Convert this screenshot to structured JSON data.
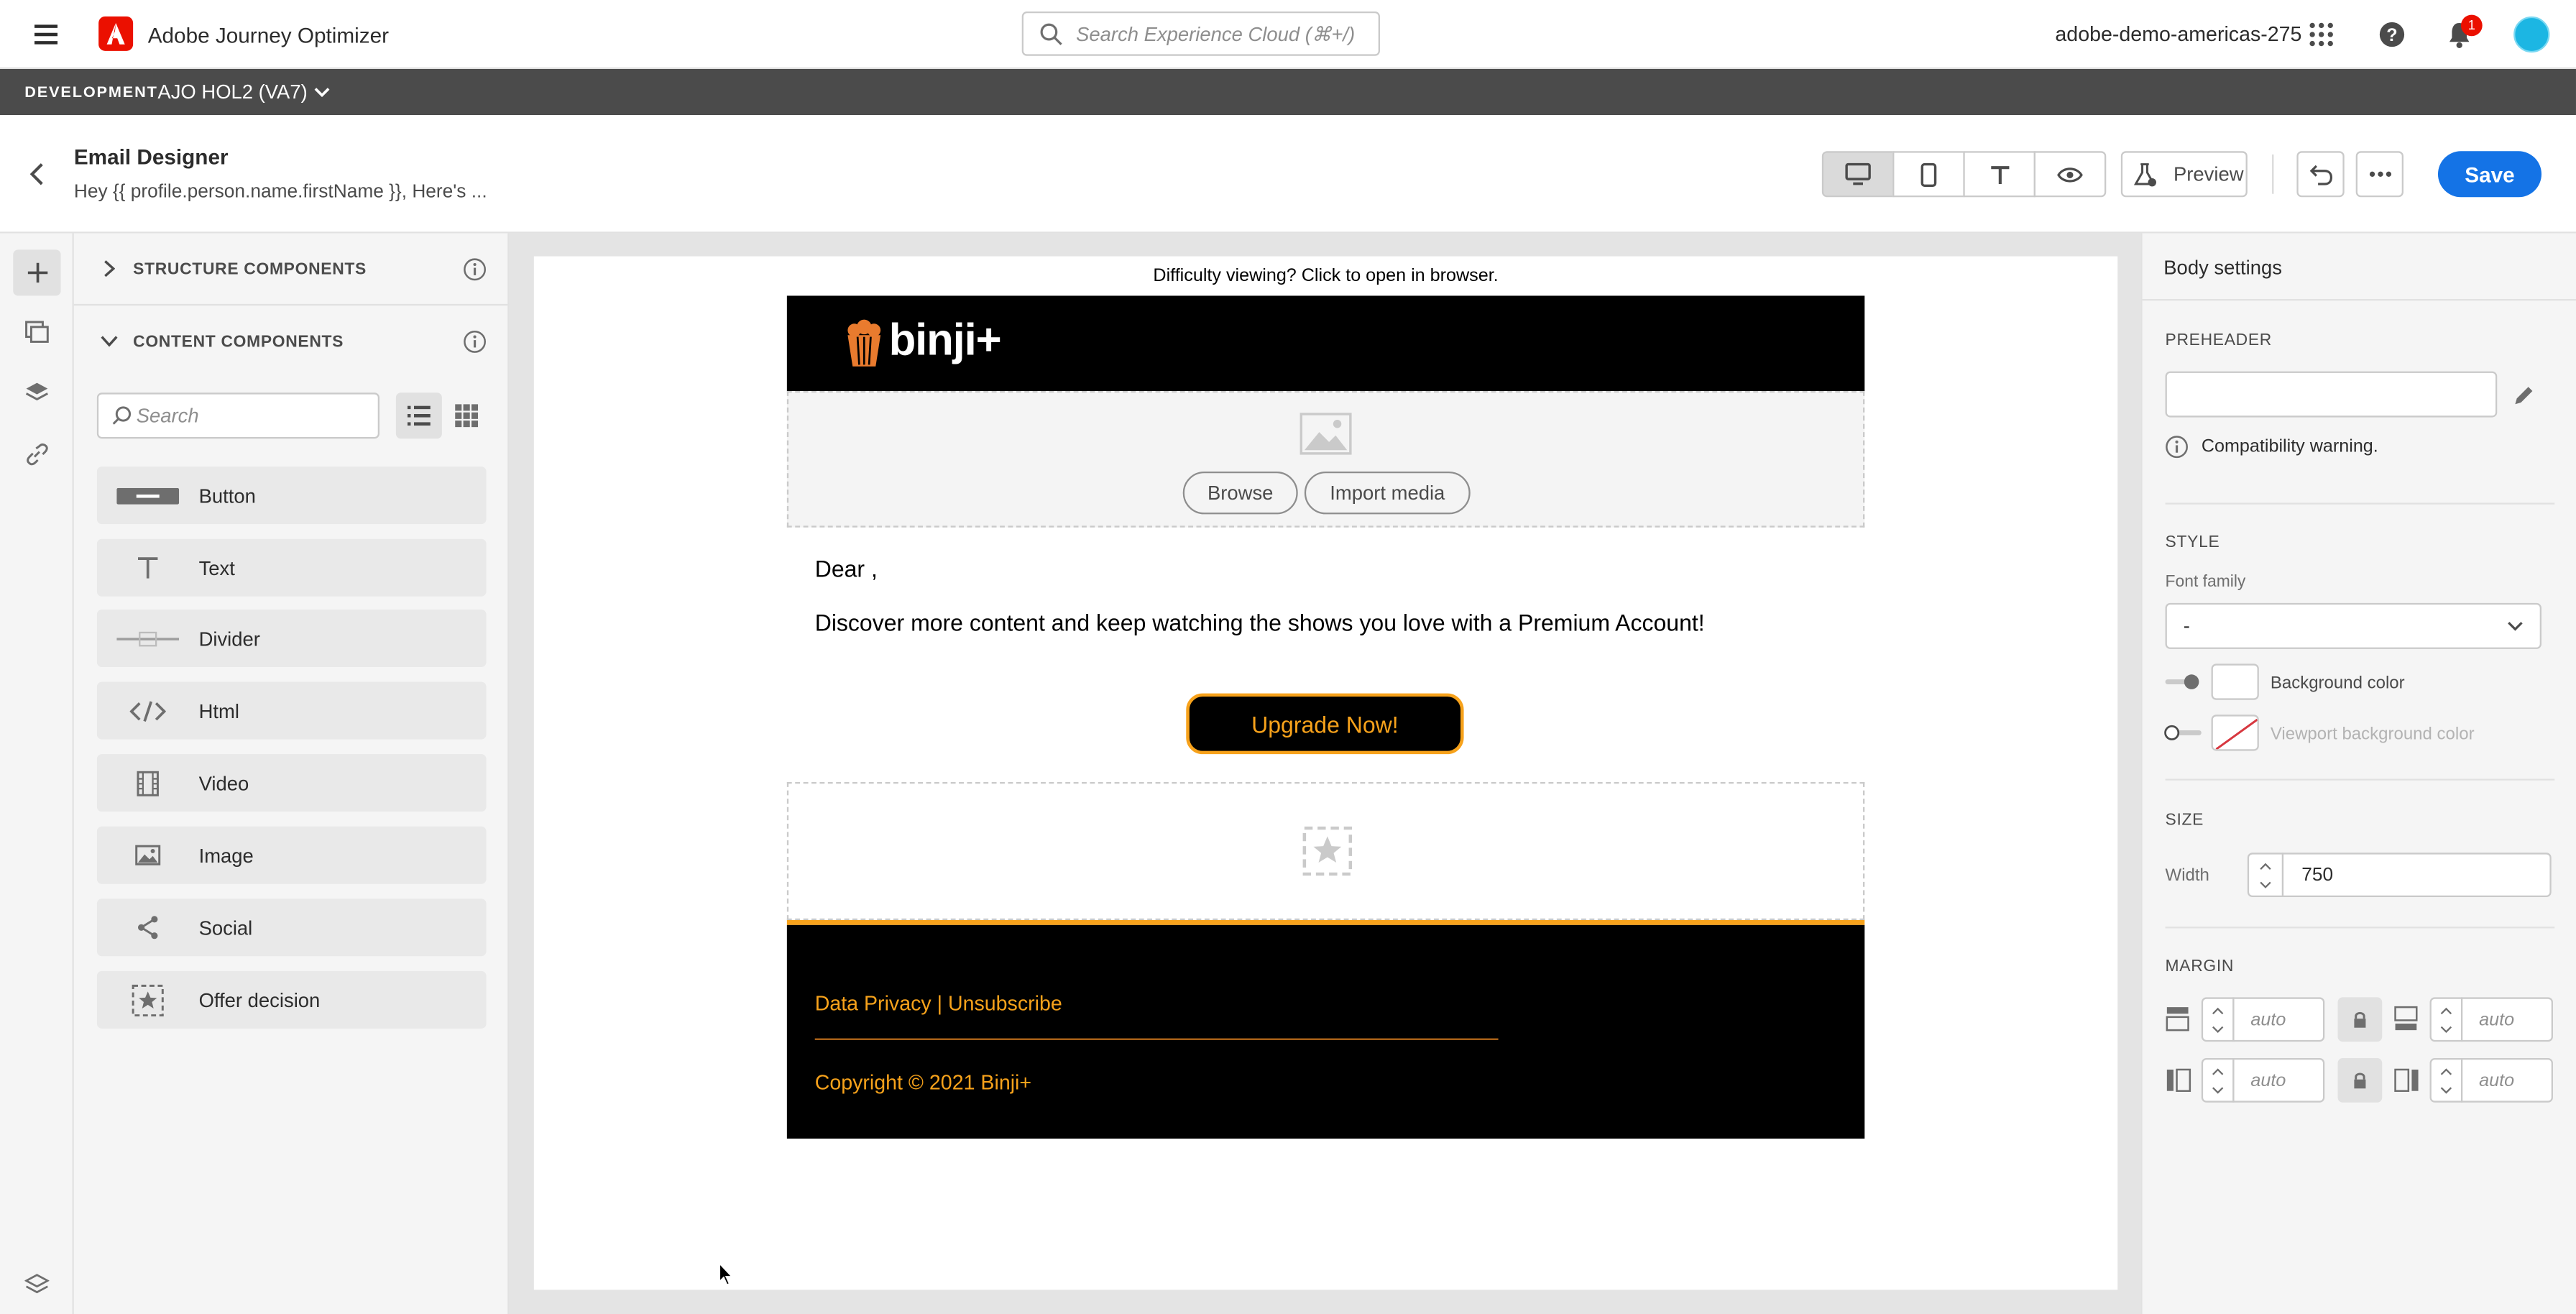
{
  "app": {
    "name": "Adobe Journey Optimizer",
    "org": "adobe-demo-americas-275",
    "notification_count": "1"
  },
  "search": {
    "placeholder": "Search Experience Cloud (⌘+/)"
  },
  "env": {
    "badge": "DEVELOPMENT",
    "sandbox": "AJO HOL2 (VA7)"
  },
  "header": {
    "title": "Email Designer",
    "subtitle": "Hey {{ profile.person.name.firstName }}, Here's ...",
    "preview_label": "Preview",
    "save_label": "Save"
  },
  "left_panel": {
    "structure_label": "STRUCTURE COMPONENTS",
    "content_label": "CONTENT COMPONENTS",
    "search_placeholder": "Search",
    "components": [
      {
        "label": "Button",
        "icon": "button-icon"
      },
      {
        "label": "Text",
        "icon": "text-icon"
      },
      {
        "label": "Divider",
        "icon": "divider-icon"
      },
      {
        "label": "Html",
        "icon": "code-icon"
      },
      {
        "label": "Video",
        "icon": "video-icon"
      },
      {
        "label": "Image",
        "icon": "image-icon"
      },
      {
        "label": "Social",
        "icon": "share-icon"
      },
      {
        "label": "Offer decision",
        "icon": "offer-decision-icon"
      }
    ]
  },
  "email": {
    "view_online": "Difficulty viewing? Click to open in browser.",
    "brand": "binji+",
    "browse_label": "Browse",
    "import_label": "Import media",
    "greeting": "Dear ,",
    "body": "Discover more content and keep watching the shows you love with a Premium Account!",
    "cta": "Upgrade Now!",
    "footer_links": "Data Privacy | Unsubscribe",
    "copyright": "Copyright © 2021 Binji+",
    "colors": {
      "accent": "#f7a21b",
      "cta_text": "#f7a21b",
      "footer_bg": "#000000"
    }
  },
  "right_panel": {
    "title": "Body settings",
    "preheader_label": "PREHEADER",
    "preheader_value": "",
    "compat_warning": "Compatibility warning.",
    "style_label": "STYLE",
    "font_family_label": "Font family",
    "font_family_value": "-",
    "bg_color_label": "Background color",
    "viewport_bg_label": "Viewport background color",
    "size_label": "SIZE",
    "width_label": "Width",
    "width_value": "750",
    "margin_label": "MARGIN",
    "margin_placeholder": "auto"
  },
  "colors": {
    "primary_blue": "#1473e6",
    "brand_red": "#eb1000"
  }
}
